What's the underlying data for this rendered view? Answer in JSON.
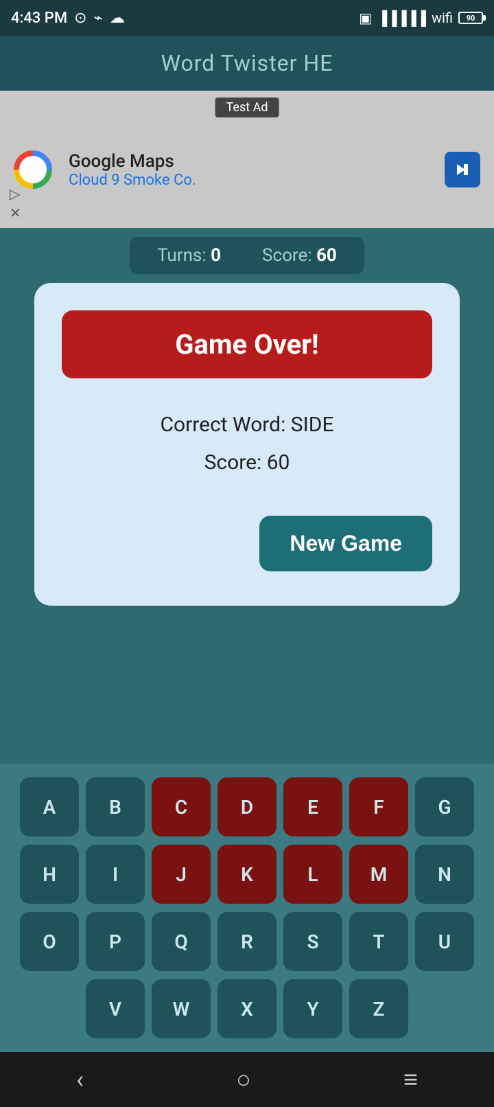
{
  "statusBar": {
    "time": "4:43 PM",
    "battery": "90"
  },
  "header": {
    "title": "Word Twister HE"
  },
  "ad": {
    "label": "Test Ad",
    "company": "Google Maps",
    "subtitle": "Cloud 9 Smoke Co."
  },
  "gameInfo": {
    "turnsLabel": "Turns:",
    "turnsValue": "0",
    "scoreLabel": "Score:",
    "scoreValue": "60"
  },
  "modal": {
    "gameOverLabel": "Game Over!",
    "correctWordLabel": "Correct Word: SIDE",
    "scoreLabel": "Score: 60",
    "newGameLabel": "New Game"
  },
  "keyboard": {
    "rows": [
      [
        "A",
        "B",
        "C",
        "D",
        "E",
        "F",
        "G"
      ],
      [
        "H",
        "I",
        "J",
        "K",
        "L",
        "M",
        "N"
      ],
      [
        "O",
        "P",
        "Q",
        "R",
        "S",
        "T",
        "U"
      ],
      [
        "V",
        "W",
        "X",
        "Y",
        "Z"
      ]
    ],
    "redKeys": [
      "C",
      "D",
      "E",
      "F",
      "J",
      "K",
      "L",
      "M"
    ]
  },
  "bottomNav": {
    "back": "‹",
    "home": "○",
    "menu": "≡"
  }
}
